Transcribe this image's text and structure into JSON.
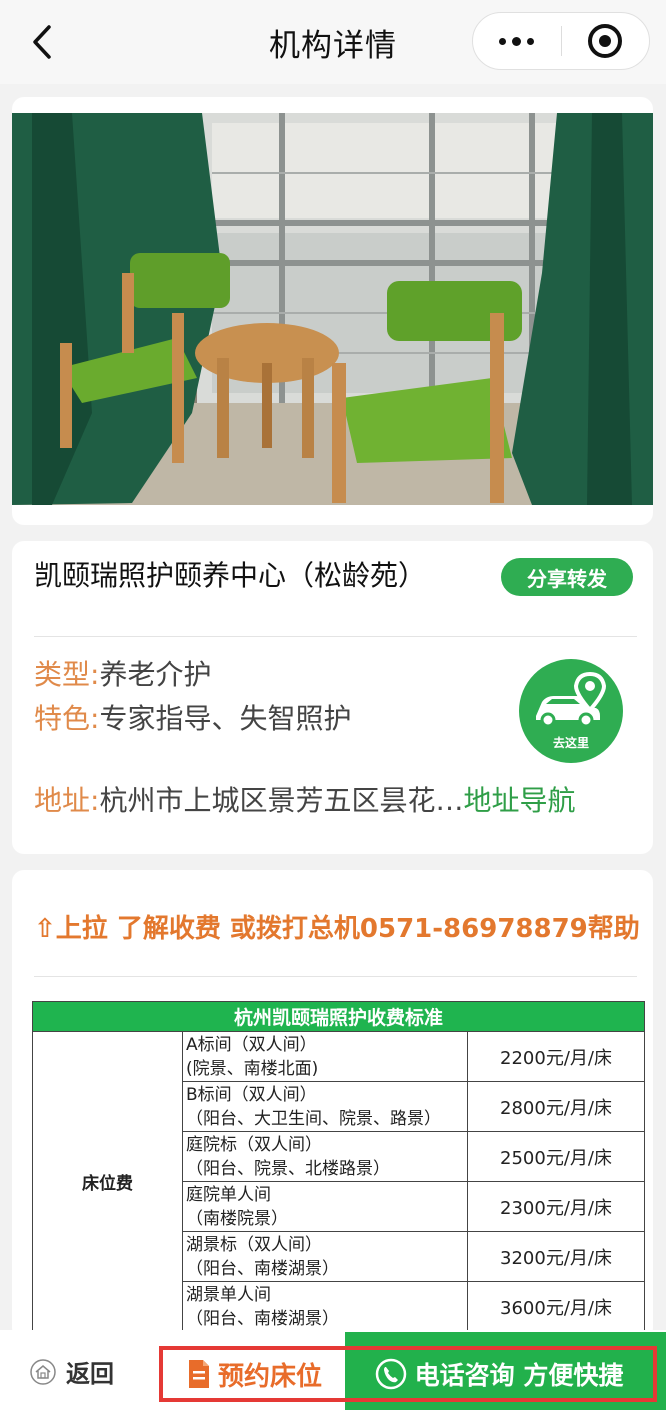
{
  "nav": {
    "title": "机构详情"
  },
  "carousel": {
    "count": 6,
    "active": 0
  },
  "org": {
    "name": "凯颐瑞照护颐养中心（松龄苑）",
    "share_label": "分享转发",
    "type_label": "类型:",
    "type_value": "养老介护",
    "feature_label": "特色:",
    "feature_value": "专家指导、失智照护",
    "address_label": "地址:",
    "address_value": "杭州市上城区景芳五区昙花…",
    "address_nav_label": "地址导航",
    "go_here_label": "去这里"
  },
  "fees": {
    "hint": "⇧上拉 了解收费 或拨打总机0571-86978879帮助",
    "table_title": "杭州凯颐瑞照护收费标准",
    "category": "床位费",
    "rows": [
      {
        "room": "A标间（双人间）",
        "detail": "(院景、南楼北面)",
        "price": "2200元/月/床"
      },
      {
        "room": "B标间（双人间）",
        "detail": "（阳台、大卫生间、院景、路景）",
        "price": "2800元/月/床"
      },
      {
        "room": "庭院标（双人间）",
        "detail": "（阳台、院景、北楼路景）",
        "price": "2500元/月/床"
      },
      {
        "room": "庭院单人间",
        "detail": "（南楼院景）",
        "price": "2300元/月/床"
      },
      {
        "room": "湖景标（双人间）",
        "detail": "（阳台、南楼湖景）",
        "price": "3200元/月/床"
      },
      {
        "room": "湖景单人间",
        "detail": "（阳台、南楼湖景）",
        "price": "3600元/月/床"
      }
    ]
  },
  "bottom_bar": {
    "back_label": "返回",
    "book_label": "预约床位",
    "call_label": "电话咨询 方便快捷"
  },
  "colors": {
    "accent_green": "#2fad52",
    "label_orange": "#e08a4a",
    "highlight_red": "#e53935"
  }
}
